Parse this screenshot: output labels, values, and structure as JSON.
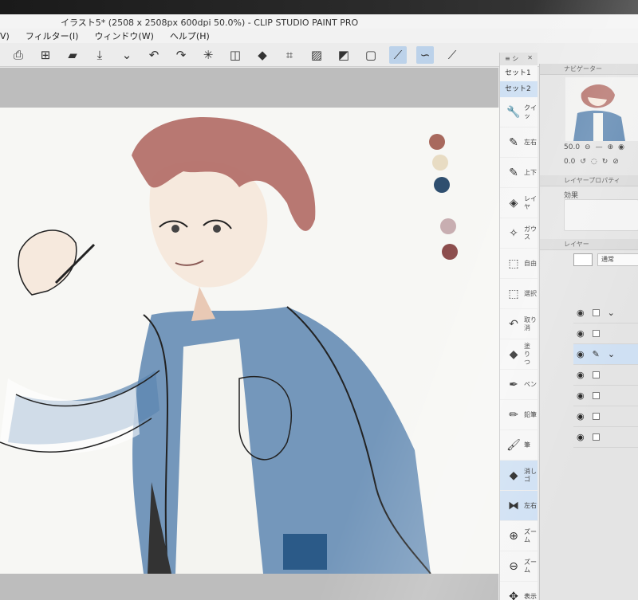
{
  "window": {
    "title": "イラスト5* (2508 x 2508px 600dpi 50.0%)  - CLIP STUDIO PAINT PRO"
  },
  "menu": {
    "items": [
      "V)",
      "フィルター(I)",
      "ウィンドウ(W)",
      "ヘルプ(H)"
    ]
  },
  "toolbar": {
    "icons": [
      "new-canvas-icon",
      "open-icon",
      "save-icon",
      "dropdown-icon",
      "undo-icon",
      "redo-icon",
      "loading-icon",
      "transform-icon",
      "fill-icon",
      "crop-icon",
      "selection-icon",
      "shade-icon",
      "frame-icon",
      "pen-active-icon",
      "brush-icon",
      "pen-icon"
    ]
  },
  "tool_panel": {
    "sets": [
      "セット1",
      "セット2"
    ],
    "tools": [
      {
        "label": "クイッ",
        "icon": "wrench-icon"
      },
      {
        "label": "左右",
        "icon": "flip-h-icon"
      },
      {
        "label": "上下",
        "icon": "flip-v-icon"
      },
      {
        "label": "レイヤ",
        "icon": "layer-icon"
      },
      {
        "label": "ガウス",
        "icon": "wand-icon"
      },
      {
        "label": "自由",
        "icon": "free-transform-icon"
      },
      {
        "label": "選択",
        "icon": "select-icon"
      },
      {
        "label": "取り消",
        "icon": "undo-icon"
      },
      {
        "label": "塗りつ",
        "icon": "bucket-icon"
      },
      {
        "label": "ペン",
        "icon": "pen-icon"
      },
      {
        "label": "鉛筆",
        "icon": "pencil-icon"
      },
      {
        "label": "筆",
        "icon": "brush-icon"
      },
      {
        "label": "消しゴ",
        "icon": "eraser-icon"
      },
      {
        "label": "左右",
        "icon": "flip-h-icon"
      },
      {
        "label": "ズーム",
        "icon": "zoom-in-icon"
      },
      {
        "label": "ズーム",
        "icon": "zoom-out-icon"
      },
      {
        "label": "表示",
        "icon": "move-icon"
      }
    ]
  },
  "navigator": {
    "title": "ナビゲーター",
    "zoom": "50.0",
    "rotation": "0.0"
  },
  "layer_property": {
    "title": "レイヤープロパティ",
    "effect_label": "効果"
  },
  "layers": {
    "title": "レイヤー",
    "blend_mode": "通常"
  },
  "palette": {
    "colors": [
      "#a8695d",
      "#e8dcc3",
      "#2f4f6f",
      "#c8aeb1",
      "#8b4c4b"
    ]
  }
}
